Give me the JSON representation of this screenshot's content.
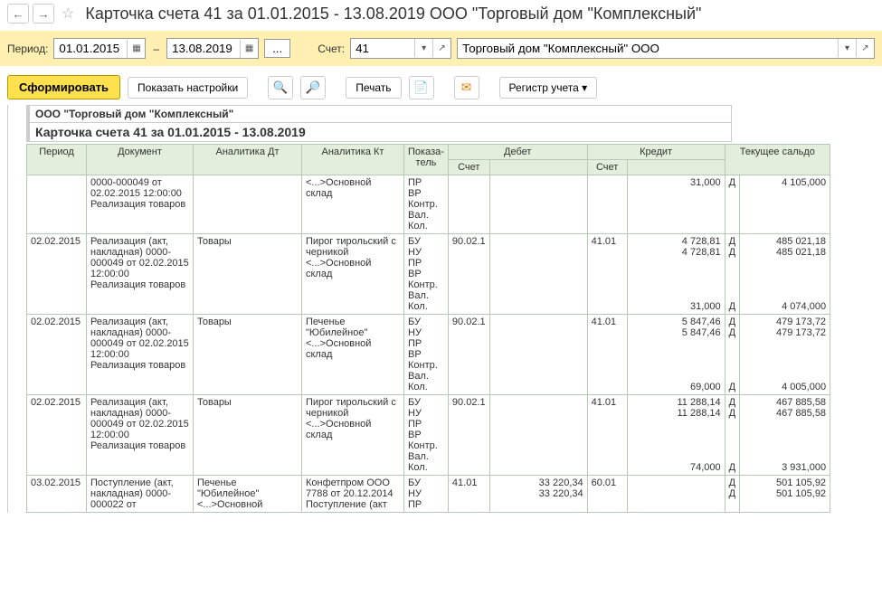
{
  "header": {
    "title": "Карточка счета 41 за 01.01.2015 - 13.08.2019 ООО \"Торговый дом \"Комплексный\""
  },
  "period": {
    "label": "Период:",
    "from": "01.01.2015",
    "to": "13.08.2019",
    "acct_label": "Счет:",
    "acct": "41",
    "org": "Торговый дом \"Комплексный\" ООО"
  },
  "toolbar": {
    "form": "Сформировать",
    "show_settings": "Показать настройки",
    "print": "Печать",
    "register": "Регистр учета"
  },
  "report": {
    "org_line": "ООО \"Торговый дом \"Комплексный\"",
    "title": "Карточка счета 41 за 01.01.2015 - 13.08.2019"
  },
  "columns": {
    "period": "Период",
    "document": "Документ",
    "analytika_dt": "Аналитика Дт",
    "analytika_kt": "Аналитика Кт",
    "pokaz": "Показа-\nтель",
    "debit": "Дебет",
    "credit": "Кредит",
    "acct": "Счет",
    "saldo": "Текущее сальдо"
  },
  "rows": [
    {
      "period": "",
      "doc": "0000-000049 от 02.02.2015 12:00:00\nРеализация товаров",
      "anadt": "",
      "anakt": "<...>Основной склад",
      "pokaz": "ПР\nВР\nКонтр.\nВал.\nКол.",
      "d_acct": "",
      "d_amt": "",
      "c_acct": "",
      "c_amt": "31,000",
      "flag": "Д",
      "saldo": "4 105,000"
    },
    {
      "period": "02.02.2015",
      "doc": "Реализация (акт, накладная) 0000-000049 от 02.02.2015 12:00:00\nРеализация товаров",
      "anadt": "Товары",
      "anakt": "Пирог тирольский с черникой\n<...>Основной склад",
      "pokaz": "БУ\nНУ\nПР\nВР\nКонтр.\nВал.\nКол.",
      "d_acct": "90.02.1",
      "d_amt": "",
      "c_acct": "41.01",
      "c_amt": "4 728,81\n4 728,81\n\n\n\n\n31,000",
      "flag": "Д\nД\n\n\n\n\nД",
      "saldo": "485 021,18\n485 021,18\n\n\n\n\n4 074,000"
    },
    {
      "period": "02.02.2015",
      "doc": "Реализация (акт, накладная) 0000-000049 от 02.02.2015 12:00:00\nРеализация товаров",
      "anadt": "Товары",
      "anakt": "Печенье \"Юбилейное\"\n<...>Основной склад",
      "pokaz": "БУ\nНУ\nПР\nВР\nКонтр.\nВал.\nКол.",
      "d_acct": "90.02.1",
      "d_amt": "",
      "c_acct": "41.01",
      "c_amt": "5 847,46\n5 847,46\n\n\n\n\n69,000",
      "flag": "Д\nД\n\n\n\n\nД",
      "saldo": "479 173,72\n479 173,72\n\n\n\n\n4 005,000"
    },
    {
      "period": "02.02.2015",
      "doc": "Реализация (акт, накладная) 0000-000049 от 02.02.2015 12:00:00\nРеализация товаров",
      "anadt": "Товары",
      "anakt": "Пирог тирольский с черникой\n<...>Основной склад",
      "pokaz": "БУ\nНУ\nПР\nВР\nКонтр.\nВал.\nКол.",
      "d_acct": "90.02.1",
      "d_amt": "",
      "c_acct": "41.01",
      "c_amt": "11 288,14\n11 288,14\n\n\n\n\n74,000",
      "flag": "Д\nД\n\n\n\n\nД",
      "saldo": "467 885,58\n467 885,58\n\n\n\n\n3 931,000"
    },
    {
      "period": "03.02.2015",
      "doc": "Поступление (акт, накладная) 0000-000022 от",
      "anadt": "Печенье \"Юбилейное\"\n<...>Основной",
      "anakt": "Конфетпром ООО\n7788 от 20.12.2014\nПоступление (акт",
      "pokaz": "БУ\nНУ\nПР",
      "d_acct": "41.01",
      "d_amt": "33 220,34\n33 220,34",
      "c_acct": "60.01",
      "c_amt": "",
      "flag": "Д\nД",
      "saldo": "501 105,92\n501 105,92"
    }
  ]
}
